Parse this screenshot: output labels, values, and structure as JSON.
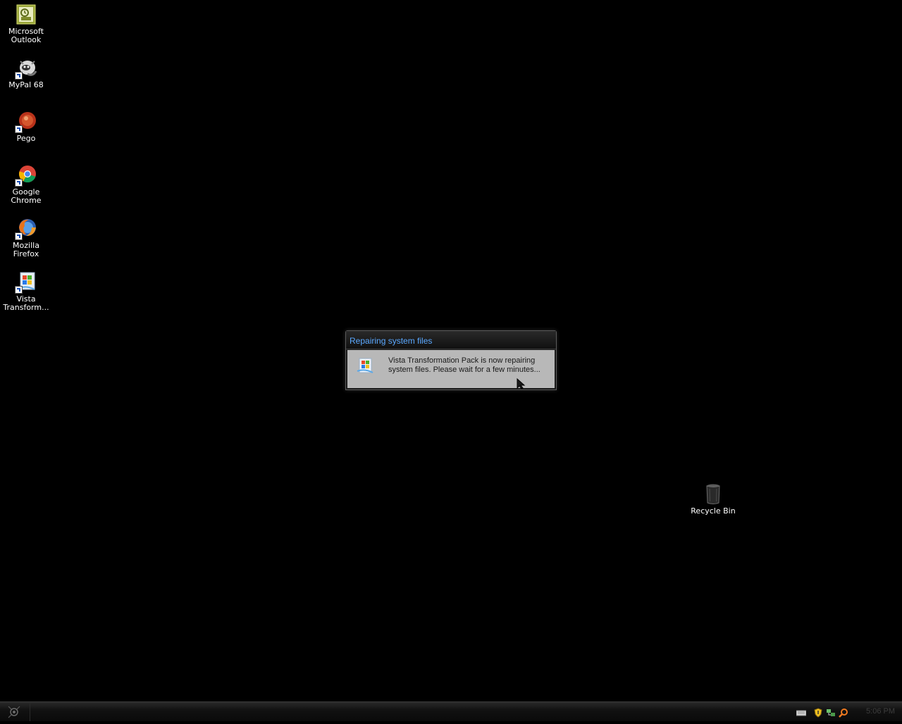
{
  "desktop_icons": [
    {
      "label": "Microsoft\nOutlook",
      "icon": "outlook-icon"
    },
    {
      "label": "MyPal 68",
      "icon": "mypal-icon"
    },
    {
      "label": "Pego",
      "icon": "pego-icon"
    },
    {
      "label": "Google\nChrome",
      "icon": "chrome-icon"
    },
    {
      "label": "Mozilla\nFirefox",
      "icon": "firefox-icon"
    },
    {
      "label": "Vista\nTransform...",
      "icon": "vista-transformation-icon"
    },
    {
      "label": "Recycle Bin",
      "icon": "recycle-bin-icon"
    }
  ],
  "dialog": {
    "title": "Repairing system files",
    "message": "Vista Transformation Pack is now repairing system files. Please wait for a few minutes..."
  },
  "taskbar": {
    "clock": "5:06 PM",
    "tray_icons": [
      "keyboard-icon",
      "security-shield-icon",
      "network-icon",
      "search-icon"
    ]
  },
  "colors": {
    "desktop_background": "#000000",
    "dialog_title": "#5aa8ff",
    "dialog_body": "#b8b8b8"
  }
}
